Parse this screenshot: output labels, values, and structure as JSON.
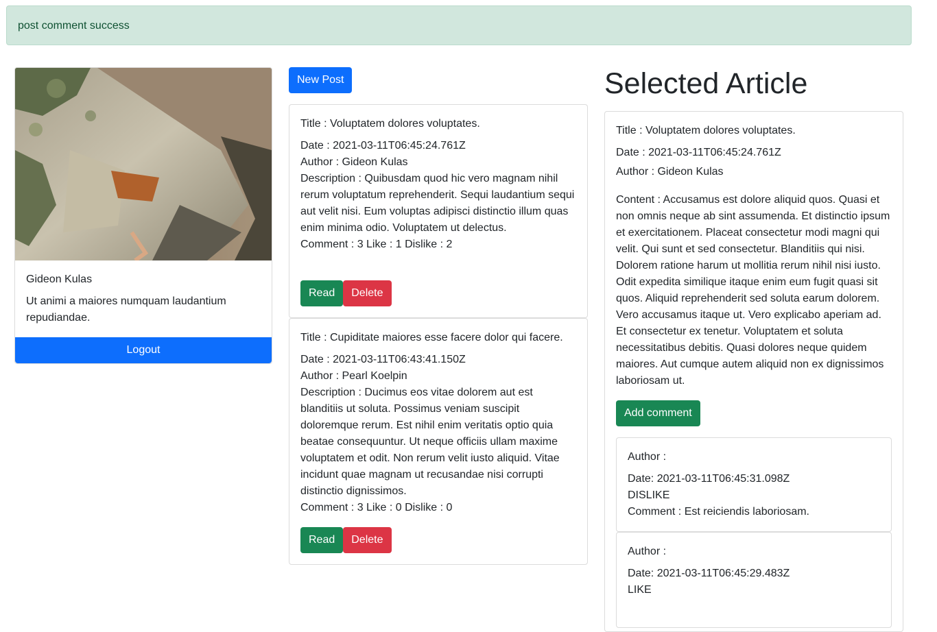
{
  "alert": {
    "message": "post comment success"
  },
  "profile": {
    "name": "Gideon Kulas",
    "bio": "Ut animi a maiores numquam laudantium repudiandae.",
    "logout_label": "Logout"
  },
  "posts": {
    "new_post_label": "New Post",
    "read_label": "Read",
    "delete_label": "Delete",
    "items": [
      {
        "title": "Title : Voluptatem dolores voluptates.",
        "date": "Date : 2021-03-11T06:45:24.761Z",
        "author": "Author : Gideon Kulas",
        "description": "Description : Quibusdam quod hic vero magnam nihil rerum voluptatum reprehenderit. Sequi laudantium sequi aut velit nisi. Eum voluptas adipisci distinctio illum quas enim minima odio. Voluptatem ut delectus.",
        "stats": "Comment : 3 Like : 1 Dislike : 2"
      },
      {
        "title": "Title : Cupiditate maiores esse facere dolor qui facere.",
        "date": "Date : 2021-03-11T06:43:41.150Z",
        "author": "Author : Pearl Koelpin",
        "description": "Description : Ducimus eos vitae dolorem aut est blanditiis ut soluta. Possimus veniam suscipit doloremque rerum. Est nihil enim veritatis optio quia beatae consequuntur. Ut neque officiis ullam maxime voluptatem et odit. Non rerum velit iusto aliquid. Vitae incidunt quae magnam ut recusandae nisi corrupti distinctio dignissimos.",
        "stats": "Comment : 3 Like : 0 Dislike : 0"
      }
    ]
  },
  "selected": {
    "heading": "Selected Article",
    "title": "Title : Voluptatem dolores voluptates.",
    "date": "Date : 2021-03-11T06:45:24.761Z",
    "author": "Author : Gideon Kulas",
    "content": "Content : Accusamus est dolore aliquid quos. Quasi et non omnis neque ab sint assumenda. Et distinctio ipsum et exercitationem. Placeat consectetur modi magni qui velit. Qui sunt et sed consectetur. Blanditiis qui nisi. Dolorem ratione harum ut mollitia rerum nihil nisi iusto. Odit expedita similique itaque enim eum fugit quasi sit quos. Aliquid reprehenderit sed soluta earum dolorem. Vero accusamus itaque ut. Vero explicabo aperiam ad. Et consectetur ex tenetur. Voluptatem et soluta necessitatibus debitis. Quasi dolores neque quidem maiores. Aut cumque autem aliquid non ex dignissimos laboriosam ut.",
    "add_comment_label": "Add comment",
    "comments": [
      {
        "author": "Author :",
        "date": "Date: 2021-03-11T06:45:31.098Z",
        "reaction": "DISLIKE",
        "comment": "Comment : Est reiciendis laboriosam."
      },
      {
        "author": "Author :",
        "date": "Date: 2021-03-11T06:45:29.483Z",
        "reaction": "LIKE",
        "comment": ""
      }
    ]
  },
  "colors": {
    "alert_bg": "#d1e7dd",
    "alert_text": "#0f5132",
    "primary": "#0d6efd",
    "success": "#198754",
    "danger": "#dc3545"
  }
}
